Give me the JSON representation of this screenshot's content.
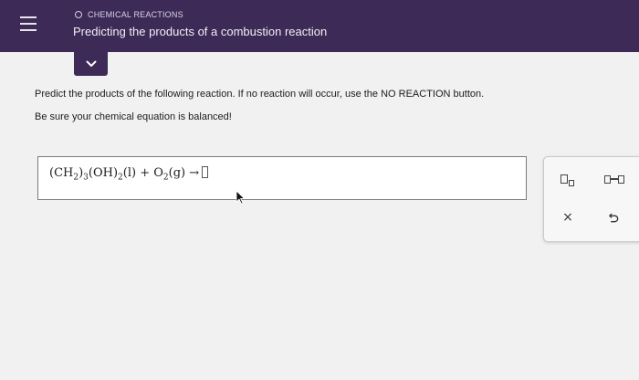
{
  "header": {
    "topic": "CHEMICAL REACTIONS",
    "title": "Predicting the products of a combustion reaction"
  },
  "instructions": {
    "line1": "Predict the products of the following reaction. If no reaction will occur, use the NO REACTION button.",
    "line2": "Be sure your chemical equation is balanced!"
  },
  "equation": {
    "open_paren": "(CH",
    "sub_h": "2",
    "close_group": ")",
    "sub_group": "3",
    "oh": "(OH)",
    "sub_oh": "2",
    "phase1": "(l)",
    "plus": " + O",
    "sub_o": "2",
    "phase2": "(g)",
    "arrow": " →"
  },
  "tools": {
    "clear_symbol": "×"
  },
  "icons": {
    "menu": "hamburger-icon",
    "collapse": "chevron-down-icon",
    "subscript": "subscript-icon",
    "reaction_arrow": "reaction-arrow-icon",
    "clear": "close-icon",
    "undo": "undo-icon"
  },
  "colors": {
    "header_bg": "#3d2a57",
    "page_bg": "#f1f1f1"
  }
}
